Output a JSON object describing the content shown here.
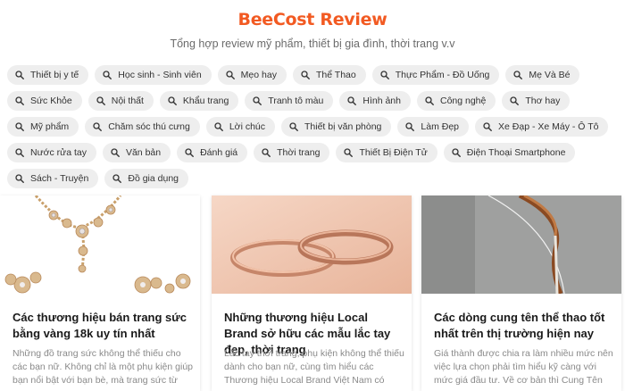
{
  "site": {
    "title": "BeeCost Review",
    "subtitle": "Tổng hợp review mỹ phẩm, thiết bị gia đình, thời trang v.v"
  },
  "tags": [
    "Thiết bị y tế",
    "Học sinh - Sinh viên",
    "Mẹo hay",
    "Thể Thao",
    "Thực Phẩm - Đồ Uống",
    "Mẹ Và Bé",
    "Sức Khỏe",
    "Nội thất",
    "Khẩu trang",
    "Tranh tô màu",
    "Hình ảnh",
    "Công nghệ",
    "Thơ hay",
    "Mỹ phẩm",
    "Chăm sóc thú cưng",
    "Lời chúc",
    "Thiết bị văn phòng",
    "Làm Đẹp",
    "Xe Đạp - Xe Máy - Ô Tô",
    "Nước rửa tay",
    "Văn bản",
    "Đánh giá",
    "Thời trang",
    "Thiết Bị Điện Tử",
    "Điện Thoại Smartphone",
    "Sách - Truyện",
    "Đồ gia dụng"
  ],
  "articles": [
    {
      "image": "gold-necklace-jewelry-image",
      "title": "Các thương hiệu bán trang sức bằng vàng 18k uy tín nhất",
      "excerpt": "Những đồ trang sức không thể thiếu cho các bạn nữ. Không chỉ là một phụ kiện giúp bạn nổi bật với bạn bè, mà trang sức từ vàng còn đem..."
    },
    {
      "image": "rose-gold-bracelets-image",
      "title": "Những thương hiệu Local Brand sở hữu các mẫu lắc tay đẹp, thời trang",
      "excerpt": "Lắc tay thời trang, phụ kiện không thể thiếu dành cho bạn nữ, cùng tìm hiểu các Thương hiệu Local Brand Việt Nam có những thiết kế lắ..."
    },
    {
      "image": "recurve-bow-image",
      "title": "Các dòng cung tên thể thao tốt nhất trên thị trường hiện nay",
      "excerpt": "Giá thành được chia ra làm nhiều mức nên việc lựa chọn phải tìm hiểu kỹ càng với mức giá đầu tư. Về cơ bản thì Cung Tên thể thao hiện nay..."
    }
  ],
  "colors": {
    "brand": "#f25a22",
    "tag_bg": "#eeeeee"
  }
}
